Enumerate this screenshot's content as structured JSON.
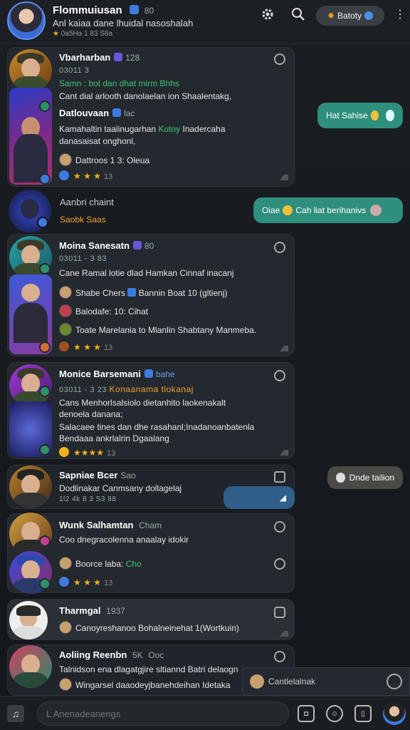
{
  "header": {
    "title": "Flommuiusan",
    "count": "80",
    "subtitle": "Anl kaiaa dane lhuidal nasoshalah",
    "meta": "0a5Ha 1 83 S8a",
    "button_label": "Batoty"
  },
  "cards": [
    {
      "title": "Vbarharban",
      "count": "128",
      "time": "03011 3",
      "green": "Samn : bot dan dhat mirm Bhhs",
      "line1": "Cant dial arlooth danolaelan ion Shaalentakg,",
      "title2": "Datlouvaan",
      "title2_extra": "lac",
      "line2a": "Kamahaltin taalinugarhan",
      "line2a_green": "Kutoy",
      "line2a_end": "Inadercaha",
      "line2b": "danasaisat onghonl,",
      "row": "Dattroos 1 3: Oleua",
      "rating": "13"
    },
    {
      "title": "Aanbri chaint",
      "sub": "Saobk Saas"
    },
    {
      "title": "Moina Sanesatn",
      "count": "80",
      "time": "03011 - 3 83",
      "line1": "Cane Ramal lotie dlad Hamkan Cinnaf inacanj",
      "row1": "Shabe Chers",
      "row1b": "Bannin Boat 10 (gltienj)",
      "row2": "Balodafe: 10: Cihat",
      "row3": "Toate Marelania to Mlanlin Shabtany Manmeba.",
      "rating": "13"
    },
    {
      "title": "Monice Barsemani",
      "tag": "bahe",
      "time": "03011 - 3 23",
      "orange": "Konaanama tlokanaj",
      "line1": "Cans Menhorlsalsiolo dietanhito laokenakalt",
      "line2": "denoela danana;",
      "line3": "Salacaee tines dan dhe rasahanl;Inadanoanbatenla",
      "line4": "Bendaaa ankrlalrin Dgaalang",
      "rating": "13"
    },
    {
      "title": "Sapniae Bcer",
      "count": "Sao",
      "line1": "Dodlinakar Canmsany dollagelaj",
      "meta": "1l2 4k 8 3 S3 88"
    },
    {
      "title": "Wunk Salhamtan",
      "green": "Cham",
      "line1": "Coo dnegracolenna anaalay idokir",
      "row": "Boorce laba:",
      "row_green": "Cho",
      "rating": "13"
    },
    {
      "title": "Tharmgal",
      "count": "1937",
      "line1": "Canoyreshanoo Bohalneinehat 1(Wortkuin)"
    },
    {
      "title": "Aoliing Reenbn",
      "orange": "5K",
      "count": "Ooc",
      "line1": "Talnidson ena dlagatgjire sltiannd Batri delaogn",
      "line2": "Wingarsel daaodeyjbanehdeihan Idetaka"
    }
  ],
  "bubbles": [
    {
      "text": "Hat Sahise"
    },
    {
      "text_a": "Oiae",
      "text_b": "Cah liat berihanivs"
    },
    {
      "text": "Dnde tailion"
    }
  ],
  "toast": {
    "text": "Cantlelalnak"
  },
  "composer": {
    "placeholder": "L Anenadeanengs"
  }
}
